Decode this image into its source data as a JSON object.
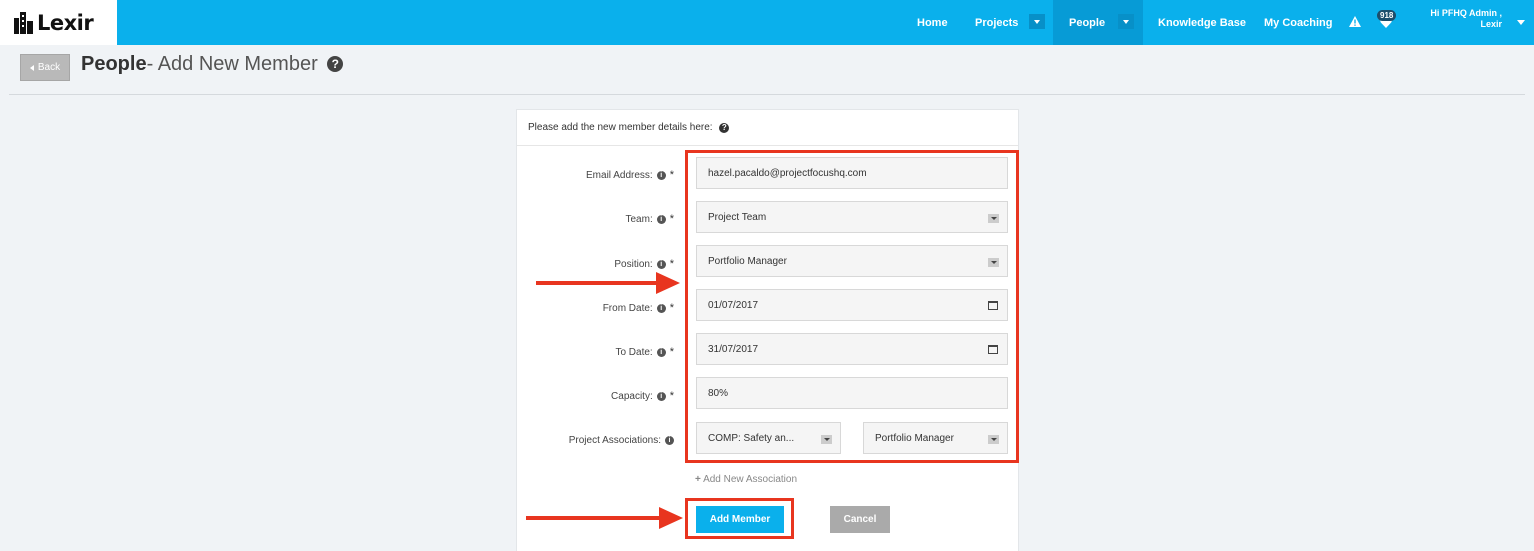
{
  "nav": {
    "logo_text": "Lexir",
    "items": [
      "Home",
      "Projects",
      "People",
      "Knowledge Base",
      "My Coaching"
    ],
    "notification_count": "918",
    "user_line1": "Hi PFHQ Admin ,",
    "user_line2": "Lexir"
  },
  "header": {
    "back_label": "Back",
    "title_bold": "People",
    "title_rest": "- Add New Member"
  },
  "form": {
    "intro": "Please add the new member details here:",
    "fields": {
      "email": {
        "label": "Email Address:",
        "value": "hazel.pacaldo@projectfocushq.com"
      },
      "team": {
        "label": "Team:",
        "value": "Project Team"
      },
      "position": {
        "label": "Position:",
        "value": "Portfolio Manager"
      },
      "from_date": {
        "label": "From Date:",
        "value": "01/07/2017"
      },
      "to_date": {
        "label": "To Date:",
        "value": "31/07/2017"
      },
      "capacity": {
        "label": "Capacity:",
        "value": "80%"
      },
      "project_assoc": {
        "label": "Project Associations:",
        "project_value": "COMP: Safety an...",
        "role_value": "Portfolio Manager"
      }
    },
    "add_association": "Add New Association",
    "add_button": "Add Member",
    "cancel_button": "Cancel"
  },
  "annotation_color": "#e8351f",
  "accent_color": "#0ab0ec"
}
